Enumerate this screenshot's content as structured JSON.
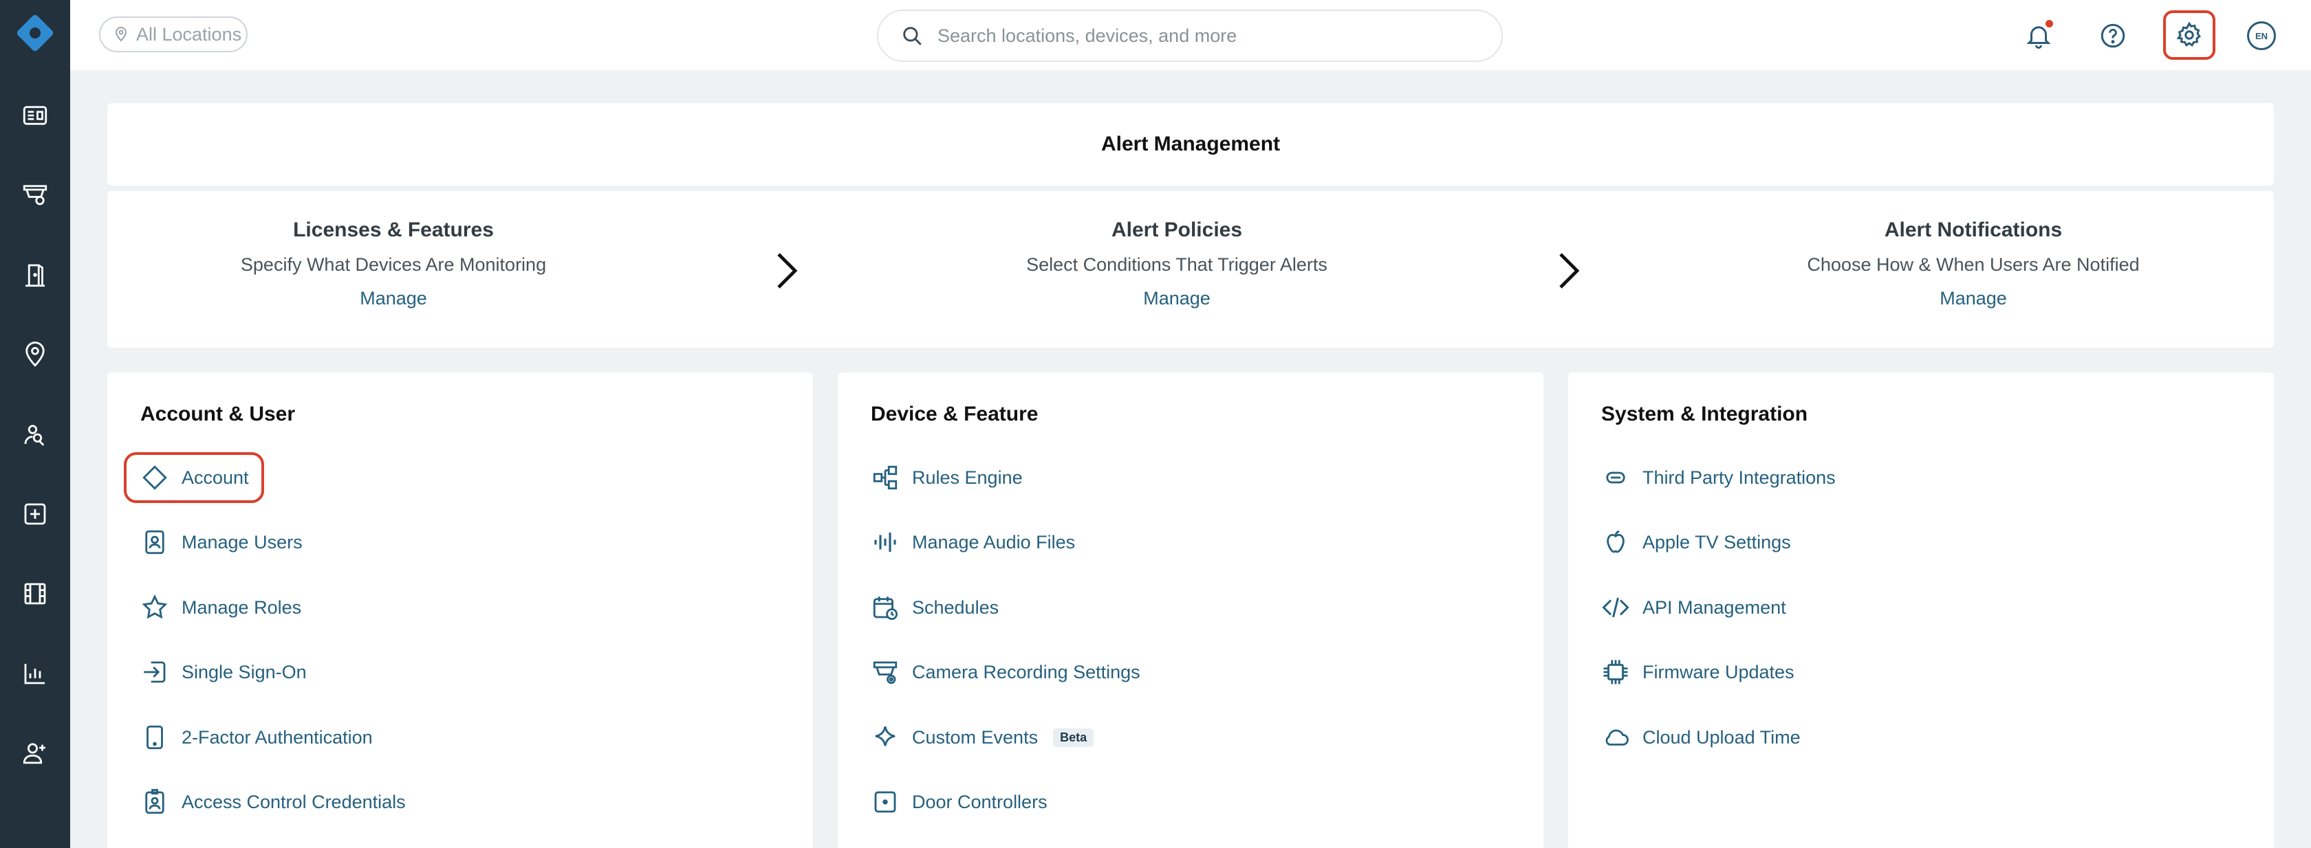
{
  "topbar": {
    "location_label": "All Locations",
    "search_placeholder": "Search locations, devices, and more",
    "language": "EN"
  },
  "alert_management": {
    "title": "Alert Management",
    "steps": [
      {
        "title": "Licenses & Features",
        "description": "Specify What Devices Are Monitoring",
        "link": "Manage"
      },
      {
        "title": "Alert Policies",
        "description": "Select Conditions That Trigger Alerts",
        "link": "Manage"
      },
      {
        "title": "Alert Notifications",
        "description": "Choose How & When Users Are Notified",
        "link": "Manage"
      }
    ]
  },
  "sections": [
    {
      "title": "Account & User",
      "items": [
        {
          "label": "Account",
          "icon": "diamond-icon"
        },
        {
          "label": "Manage Users",
          "icon": "user-badge-icon"
        },
        {
          "label": "Manage Roles",
          "icon": "star-icon"
        },
        {
          "label": "Single Sign-On",
          "icon": "sign-in-icon"
        },
        {
          "label": "2-Factor Authentication",
          "icon": "tablet-icon"
        },
        {
          "label": "Access Control Credentials",
          "icon": "id-badge-icon"
        }
      ]
    },
    {
      "title": "Device & Feature",
      "items": [
        {
          "label": "Rules Engine",
          "icon": "rules-icon"
        },
        {
          "label": "Manage Audio Files",
          "icon": "audio-wave-icon"
        },
        {
          "label": "Schedules",
          "icon": "calendar-clock-icon"
        },
        {
          "label": "Camera Recording Settings",
          "icon": "camera-settings-icon"
        },
        {
          "label": "Custom Events",
          "icon": "sparkle-icon",
          "badge": "Beta"
        },
        {
          "label": "Door Controllers",
          "icon": "door-controller-icon"
        }
      ]
    },
    {
      "title": "System & Integration",
      "items": [
        {
          "label": "Third Party Integrations",
          "icon": "link-icon"
        },
        {
          "label": "Apple TV Settings",
          "icon": "apple-icon"
        },
        {
          "label": "API Management",
          "icon": "code-icon"
        },
        {
          "label": "Firmware Updates",
          "icon": "chip-icon"
        },
        {
          "label": "Cloud Upload Time",
          "icon": "cloud-icon"
        }
      ]
    }
  ],
  "colors": {
    "sidebar": "#22313b",
    "accent": "#25607f",
    "highlight": "#d9412b",
    "background": "#eff1f3"
  }
}
